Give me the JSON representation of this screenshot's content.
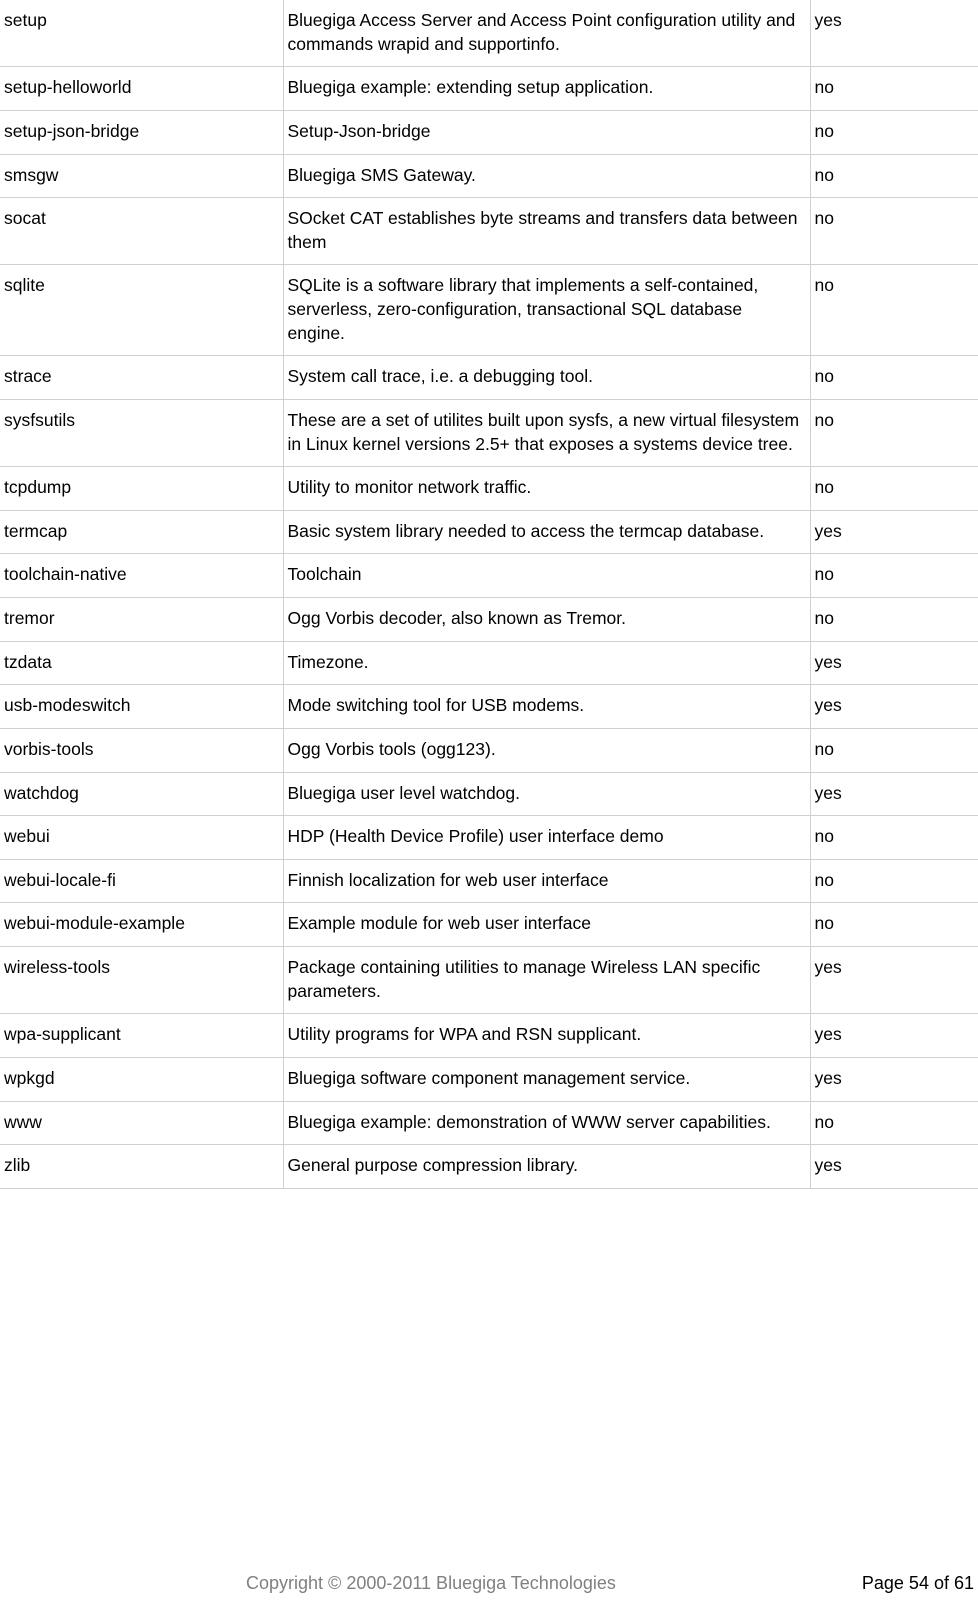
{
  "table": {
    "rows": [
      {
        "name": "setup",
        "desc": "Bluegiga Access Server and Access Point configuration utility and commands wrapid and supportinfo.",
        "flag": "yes"
      },
      {
        "name": "setup-helloworld",
        "desc": "Bluegiga example: extending setup application.",
        "flag": "no"
      },
      {
        "name": "setup-json-bridge",
        "desc": "Setup-Json-bridge",
        "flag": "no"
      },
      {
        "name": "smsgw",
        "desc": "Bluegiga SMS Gateway.",
        "flag": "no"
      },
      {
        "name": "socat",
        "desc": "SOcket CAT establishes byte streams and transfers data between them",
        "flag": "no"
      },
      {
        "name": "sqlite",
        "desc": "SQLite is a software library that implements a self-contained, serverless, zero-configuration, transactional SQL database engine.",
        "flag": "no"
      },
      {
        "name": "strace",
        "desc": "System call trace, i.e. a debugging tool.",
        "flag": "no"
      },
      {
        "name": "sysfsutils",
        "desc": "These are a set of utilites built upon sysfs, a new virtual filesystem in Linux kernel versions 2.5+ that exposes a systems device tree.",
        "flag": "no"
      },
      {
        "name": "tcpdump",
        "desc": "Utility to monitor network traffic.",
        "flag": "no"
      },
      {
        "name": "termcap",
        "desc": "Basic system library needed to access the termcap database.",
        "flag": "yes"
      },
      {
        "name": "toolchain-native",
        "desc": "Toolchain",
        "flag": "no"
      },
      {
        "name": "tremor",
        "desc": "Ogg Vorbis decoder, also known as Tremor.",
        "flag": "no"
      },
      {
        "name": "tzdata",
        "desc": "Timezone.",
        "flag": "yes"
      },
      {
        "name": "usb-modeswitch",
        "desc": "Mode switching tool for USB modems.",
        "flag": "yes"
      },
      {
        "name": "vorbis-tools",
        "desc": "Ogg Vorbis tools (ogg123).",
        "flag": "no"
      },
      {
        "name": "watchdog",
        "desc": "Bluegiga user level watchdog.",
        "flag": "yes"
      },
      {
        "name": "webui",
        "desc": "HDP (Health Device Profile) user interface demo",
        "flag": "no"
      },
      {
        "name": "webui-locale-fi",
        "desc": "Finnish localization for web user interface",
        "flag": "no"
      },
      {
        "name": "webui-module-example",
        "desc": "Example module for web user interface",
        "flag": "no"
      },
      {
        "name": "wireless-tools",
        "desc": "Package containing utilities to manage Wireless LAN specific parameters.",
        "flag": "yes"
      },
      {
        "name": "wpa-supplicant",
        "desc": "Utility programs for WPA and RSN supplicant.",
        "flag": "yes"
      },
      {
        "name": "wpkgd",
        "desc": "Bluegiga software component management service.",
        "flag": "yes"
      },
      {
        "name": "www",
        "desc": "Bluegiga example: demonstration of WWW server capabilities.",
        "flag": "no"
      },
      {
        "name": "zlib",
        "desc": "General purpose compression library.",
        "flag": "yes"
      }
    ]
  },
  "footer": {
    "copyright": "Copyright © 2000-2011 Bluegiga Technologies",
    "page": "Page 54 of 61"
  }
}
